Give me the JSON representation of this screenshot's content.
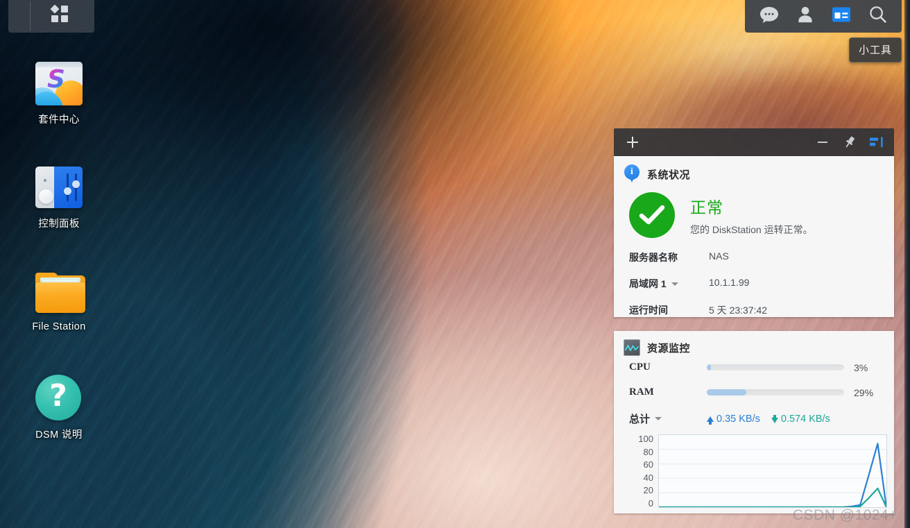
{
  "taskbar": {
    "main_menu_label": "main-menu",
    "tray": [
      {
        "name": "notifications-icon",
        "label": "通知"
      },
      {
        "name": "user-icon",
        "label": "用户"
      },
      {
        "name": "widgets-icon",
        "label": "小工具"
      },
      {
        "name": "search-icon",
        "label": "搜索"
      }
    ],
    "tooltip": "小工具"
  },
  "desktop_icons": [
    {
      "label": "套件中心",
      "icon": "package-center-icon"
    },
    {
      "label": "控制面板",
      "icon": "control-panel-icon"
    },
    {
      "label": "File Station",
      "icon": "file-station-icon"
    },
    {
      "label": "DSM 说明",
      "icon": "dsm-help-icon"
    }
  ],
  "widget": {
    "header": {
      "add_label": "+",
      "minimize_label": "−",
      "pin_label": "pin",
      "dock_label": "dock-right"
    },
    "system_health": {
      "title": "系统状况",
      "status": "正常",
      "status_color": "#19a819",
      "description": "您的 DiskStation 运转正常。",
      "rows": [
        {
          "key": "服务器名称",
          "value": "NAS",
          "has_caret": false
        },
        {
          "key": "局域网 1",
          "value": "10.1.1.99",
          "has_caret": true
        },
        {
          "key": "运行时间",
          "value": "5 天 23:37:42",
          "has_caret": false
        }
      ]
    },
    "resource_monitor": {
      "title": "资源监控",
      "cpu_label": "CPU",
      "cpu_value": "3%",
      "cpu_percent": 3,
      "ram_label": "RAM",
      "ram_value": "29%",
      "ram_percent": 29,
      "total_label": "总计",
      "upload_value": "0.35 KB/s",
      "upload_color": "#2b7fd4",
      "download_value": "0.574 KB/s",
      "download_color": "#1aa899"
    }
  },
  "watermark": "CSDN @1024+",
  "chart_data": {
    "type": "line",
    "title": "",
    "xlabel": "",
    "ylabel": "",
    "ylim": [
      0,
      100
    ],
    "yticks": [
      100,
      80,
      60,
      40,
      20,
      0
    ],
    "grid": true,
    "legend": "none",
    "x": [
      0,
      1,
      2,
      3,
      4,
      5,
      6,
      7,
      8,
      9,
      10,
      11,
      12,
      13,
      14,
      15,
      16,
      17,
      18,
      19,
      20,
      21,
      22,
      23,
      24,
      25,
      26
    ],
    "series": [
      {
        "name": "上传",
        "color": "#2b7fd4",
        "values": [
          0,
          0,
          0,
          0,
          0,
          0,
          0,
          0,
          0,
          0,
          0,
          0,
          0,
          0,
          0,
          0,
          0,
          0,
          0,
          0,
          0,
          0,
          1,
          3,
          45,
          88,
          0
        ]
      },
      {
        "name": "下载",
        "color": "#1aa899",
        "values": [
          0,
          0,
          0,
          0,
          0,
          0,
          0,
          0,
          0,
          0,
          0,
          0,
          0,
          0,
          0,
          0,
          0,
          0,
          0,
          0,
          0,
          0,
          0,
          1,
          13,
          26,
          0
        ]
      }
    ]
  }
}
